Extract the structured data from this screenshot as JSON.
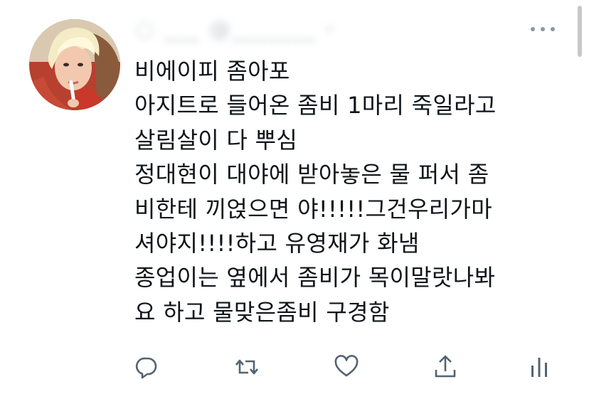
{
  "tweet": {
    "author_name": "○ ___ @_______ ·",
    "text_lines": [
      "비에이피 좀아포",
      "아지트로 들어온 좀비 1마리 죽일라고",
      "살림살이 다 뿌심",
      "정대현이 대야에 받아놓은 물 퍼서 좀",
      "비한테 끼얹으면 야!!!!!그건우리가마",
      "셔야지!!!!하고 유영재가 화냄",
      "종업이는 옆에서 좀비가 목이말랏나봐",
      "요 하고 물맞은좀비 구경함"
    ],
    "actions": [
      "reply-icon",
      "retweet-icon",
      "like-icon",
      "share-icon",
      "analytics-icon"
    ]
  },
  "colors": {
    "text": "#0f1419",
    "icon": "#536471",
    "avatar_bg": "#a33a2c",
    "avatar_hair": "#f3e9b9"
  }
}
